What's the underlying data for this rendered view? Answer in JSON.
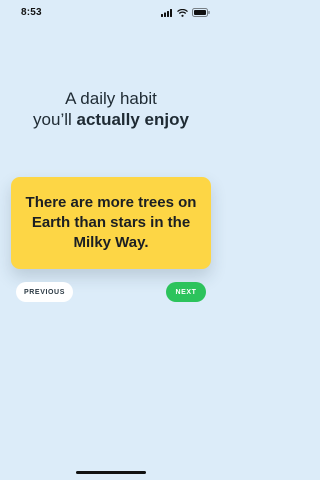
{
  "status_bar": {
    "time": "8:53",
    "icons": [
      "signal-icon",
      "wifi-icon",
      "battery-icon"
    ]
  },
  "headline": {
    "line1": "A daily habit",
    "line2_prefix": "you’ll ",
    "line2_emphasis": "actually enjoy"
  },
  "fact_card": {
    "text": "There are more trees on Earth than stars in the Milky Way.",
    "color": "#fdd645"
  },
  "navigation": {
    "previous_label": "PREVIOUS",
    "next_label": "NEXT",
    "next_color": "#2cc35c"
  },
  "theme": {
    "background": "#dcecf9"
  }
}
